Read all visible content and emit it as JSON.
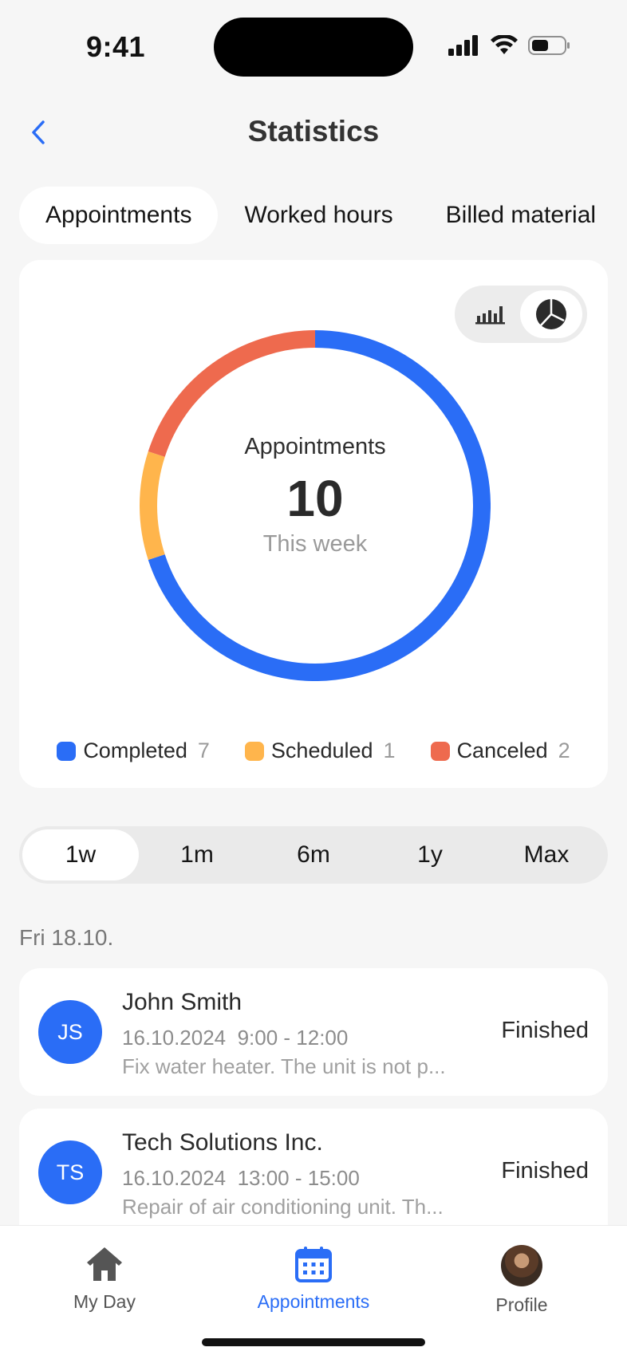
{
  "status_bar": {
    "time": "9:41"
  },
  "header": {
    "title": "Statistics"
  },
  "tabs": [
    {
      "label": "Appointments",
      "active": true
    },
    {
      "label": "Worked hours",
      "active": false
    },
    {
      "label": "Billed material",
      "active": false
    }
  ],
  "chart": {
    "center_title": "Appointments",
    "center_value": "10",
    "center_sub": "This week",
    "view_modes": [
      "bar-chart-icon",
      "pie-chart-icon"
    ],
    "selected_view": "pie-chart-icon"
  },
  "chart_data": {
    "type": "pie",
    "categories": [
      "Completed",
      "Scheduled",
      "Canceled"
    ],
    "values": [
      7,
      1,
      2
    ],
    "colors": [
      "#2a6df6",
      "#ffb54c",
      "#ee6a4e"
    ],
    "total": 10
  },
  "legend": [
    {
      "label": "Completed",
      "count": "7",
      "color": "#2a6df6"
    },
    {
      "label": "Scheduled",
      "count": "1",
      "color": "#ffb54c"
    },
    {
      "label": "Canceled",
      "count": "2",
      "color": "#ee6a4e"
    }
  ],
  "range": {
    "options": [
      "1w",
      "1m",
      "6m",
      "1y",
      "Max"
    ],
    "selected": "1w"
  },
  "list": {
    "date_header": "Fri 18.10.",
    "items": [
      {
        "initials": "JS",
        "name": "John Smith",
        "date": "16.10.2024",
        "time": "9:00 - 12:00",
        "meta": "16.10.2024  9:00 - 12:00",
        "description": "Fix water heater. The unit is not p...",
        "status": "Finished"
      },
      {
        "initials": "TS",
        "name": "Tech Solutions Inc.",
        "date": "16.10.2024",
        "time": "13:00 - 15:00",
        "meta": "16.10.2024  13:00 - 15:00",
        "description": "Repair of air conditioning unit. Th...",
        "status": "Finished"
      }
    ]
  },
  "bottom_nav": [
    {
      "label": "My Day",
      "icon": "home-icon",
      "active": false
    },
    {
      "label": "Appointments",
      "icon": "calendar-icon",
      "active": true
    },
    {
      "label": "Profile",
      "icon": "profile-avatar",
      "active": false
    }
  ],
  "colors": {
    "accent": "#2a6df6"
  }
}
